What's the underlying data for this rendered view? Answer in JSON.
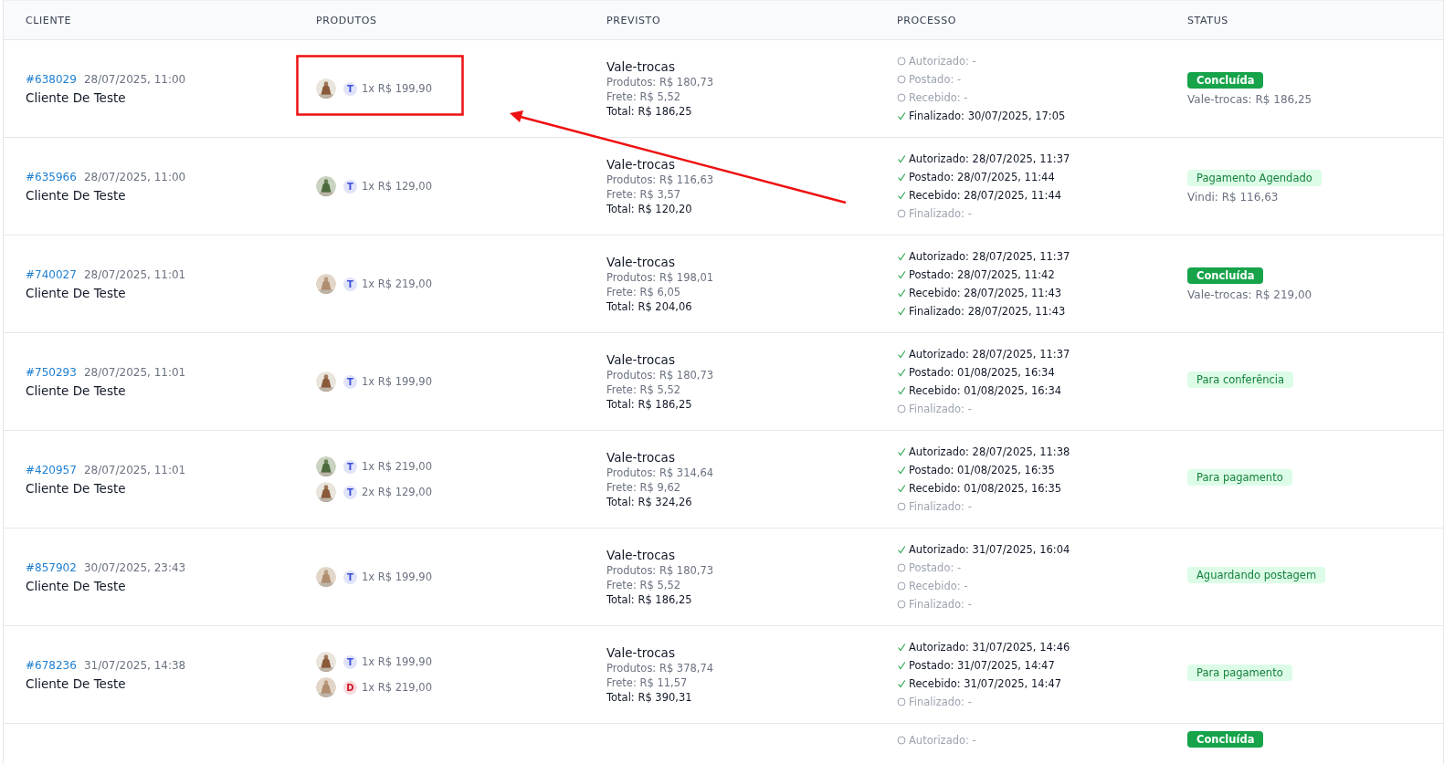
{
  "columns": [
    "CLIENTE",
    "PRODUTOS",
    "PREVISTO",
    "PROCESSO",
    "STATUS"
  ],
  "rows": [
    {
      "order": "#638029",
      "date": "28/07/2025, 11:00",
      "customer": "Cliente De Teste",
      "products": [
        {
          "tag": "T",
          "color": "#3b4fd8",
          "text": "1x R$ 199,90"
        }
      ],
      "forecast": {
        "title": "Vale-trocas",
        "products": "Produtos: R$ 180,73",
        "shipping": "Frete: R$ 5,52",
        "total": "Total: R$ 186,25"
      },
      "steps": [
        {
          "text": "Autorizado: -",
          "done": false
        },
        {
          "text": "Postado: -",
          "done": false
        },
        {
          "text": "Recebido: -",
          "done": false
        },
        {
          "text": "Finalizado: 30/07/2025, 17:05",
          "done": true
        }
      ],
      "status": {
        "label": "Concluída",
        "kind": "solid"
      },
      "status_note": "Vale-trocas: R$ 186,25"
    },
    {
      "order": "#635966",
      "date": "28/07/2025, 11:00",
      "customer": "Cliente De Teste",
      "products": [
        {
          "tag": "T",
          "color": "#3b4fd8",
          "text": "1x R$ 129,00"
        }
      ],
      "forecast": {
        "title": "Vale-trocas",
        "products": "Produtos: R$ 116,63",
        "shipping": "Frete: R$ 3,57",
        "total": "Total: R$ 120,20"
      },
      "steps": [
        {
          "text": "Autorizado: 28/07/2025, 11:37",
          "done": true
        },
        {
          "text": "Postado: 28/07/2025, 11:44",
          "done": true
        },
        {
          "text": "Recebido: 28/07/2025, 11:44",
          "done": true
        },
        {
          "text": "Finalizado: -",
          "done": false
        }
      ],
      "status": {
        "label": "Pagamento Agendado",
        "kind": "soft"
      },
      "status_note": "Vindi: R$ 116,63"
    },
    {
      "order": "#740027",
      "date": "28/07/2025, 11:01",
      "customer": "Cliente De Teste",
      "products": [
        {
          "tag": "T",
          "color": "#3b4fd8",
          "text": "1x R$ 219,00"
        }
      ],
      "forecast": {
        "title": "Vale-trocas",
        "products": "Produtos: R$ 198,01",
        "shipping": "Frete: R$ 6,05",
        "total": "Total: R$ 204,06"
      },
      "steps": [
        {
          "text": "Autorizado: 28/07/2025, 11:37",
          "done": true
        },
        {
          "text": "Postado: 28/07/2025, 11:42",
          "done": true
        },
        {
          "text": "Recebido: 28/07/2025, 11:43",
          "done": true
        },
        {
          "text": "Finalizado: 28/07/2025, 11:43",
          "done": true
        }
      ],
      "status": {
        "label": "Concluída",
        "kind": "solid"
      },
      "status_note": "Vale-trocas: R$ 219,00"
    },
    {
      "order": "#750293",
      "date": "28/07/2025, 11:01",
      "customer": "Cliente De Teste",
      "products": [
        {
          "tag": "T",
          "color": "#3b4fd8",
          "text": "1x R$ 199,90"
        }
      ],
      "forecast": {
        "title": "Vale-trocas",
        "products": "Produtos: R$ 180,73",
        "shipping": "Frete: R$ 5,52",
        "total": "Total: R$ 186,25"
      },
      "steps": [
        {
          "text": "Autorizado: 28/07/2025, 11:37",
          "done": true
        },
        {
          "text": "Postado: 01/08/2025, 16:34",
          "done": true
        },
        {
          "text": "Recebido: 01/08/2025, 16:34",
          "done": true
        },
        {
          "text": "Finalizado: -",
          "done": false
        }
      ],
      "status": {
        "label": "Para conferência",
        "kind": "soft"
      }
    },
    {
      "order": "#420957",
      "date": "28/07/2025, 11:01",
      "customer": "Cliente De Teste",
      "products": [
        {
          "tag": "T",
          "color": "#3b4fd8",
          "text": "1x R$ 219,00"
        },
        {
          "tag": "T",
          "color": "#3b4fd8",
          "text": "2x R$ 129,00"
        }
      ],
      "forecast": {
        "title": "Vale-trocas",
        "products": "Produtos: R$ 314,64",
        "shipping": "Frete: R$ 9,62",
        "total": "Total: R$ 324,26"
      },
      "steps": [
        {
          "text": "Autorizado: 28/07/2025, 11:38",
          "done": true
        },
        {
          "text": "Postado: 01/08/2025, 16:35",
          "done": true
        },
        {
          "text": "Recebido: 01/08/2025, 16:35",
          "done": true
        },
        {
          "text": "Finalizado: -",
          "done": false
        }
      ],
      "status": {
        "label": "Para pagamento",
        "kind": "soft"
      }
    },
    {
      "order": "#857902",
      "date": "30/07/2025, 23:43",
      "customer": "Cliente De Teste",
      "products": [
        {
          "tag": "T",
          "color": "#3b4fd8",
          "text": "1x R$ 199,90"
        }
      ],
      "forecast": {
        "title": "Vale-trocas",
        "products": "Produtos: R$ 180,73",
        "shipping": "Frete: R$ 5,52",
        "total": "Total: R$ 186,25"
      },
      "steps": [
        {
          "text": "Autorizado: 31/07/2025, 16:04",
          "done": true
        },
        {
          "text": "Postado: -",
          "done": false
        },
        {
          "text": "Recebido: -",
          "done": false
        },
        {
          "text": "Finalizado: -",
          "done": false
        }
      ],
      "status": {
        "label": "Aguardando postagem",
        "kind": "soft"
      }
    },
    {
      "order": "#678236",
      "date": "31/07/2025, 14:38",
      "customer": "Cliente De Teste",
      "products": [
        {
          "tag": "T",
          "color": "#3b4fd8",
          "text": "1x R$ 199,90"
        },
        {
          "tag": "D",
          "color": "#d11a2a",
          "text": "1x R$ 219,00"
        }
      ],
      "forecast": {
        "title": "Vale-trocas",
        "products": "Produtos: R$ 378,74",
        "shipping": "Frete: R$ 11,57",
        "total": "Total: R$ 390,31"
      },
      "steps": [
        {
          "text": "Autorizado: 31/07/2025, 14:46",
          "done": true
        },
        {
          "text": "Postado: 31/07/2025, 14:47",
          "done": true
        },
        {
          "text": "Recebido: 31/07/2025, 14:47",
          "done": true
        },
        {
          "text": "Finalizado: -",
          "done": false
        }
      ],
      "status": {
        "label": "Para pagamento",
        "kind": "soft"
      }
    },
    {
      "steps": [
        {
          "text": "Autorizado: -",
          "done": false
        }
      ],
      "status": {
        "label": "Concluída",
        "kind": "solid"
      }
    }
  ]
}
